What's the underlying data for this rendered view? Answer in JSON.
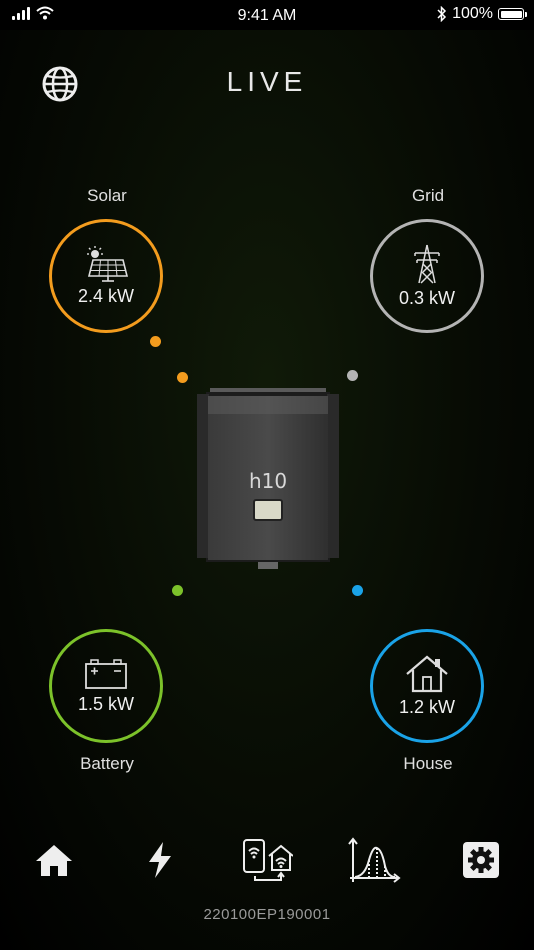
{
  "status_bar": {
    "time": "9:41 AM",
    "battery": "100%"
  },
  "header": {
    "title": "LIVE"
  },
  "nodes": {
    "solar": {
      "label": "Solar",
      "value": "2.4 kW",
      "color": "#f39c1e"
    },
    "grid": {
      "label": "Grid",
      "value": "0.3 kW",
      "color": "#b4b4b4"
    },
    "battery": {
      "label": "Battery",
      "value": "1.5 kW",
      "color": "#7cc22a"
    },
    "house": {
      "label": "House",
      "value": "1.2 kW",
      "color": "#1aa3e8"
    }
  },
  "inverter": {
    "model": "h10"
  },
  "nav": {
    "icons": [
      "home-icon",
      "lightning-icon",
      "connection-icon",
      "chart-icon",
      "gear-icon"
    ]
  },
  "footer": {
    "serial": "220100EP190001"
  }
}
